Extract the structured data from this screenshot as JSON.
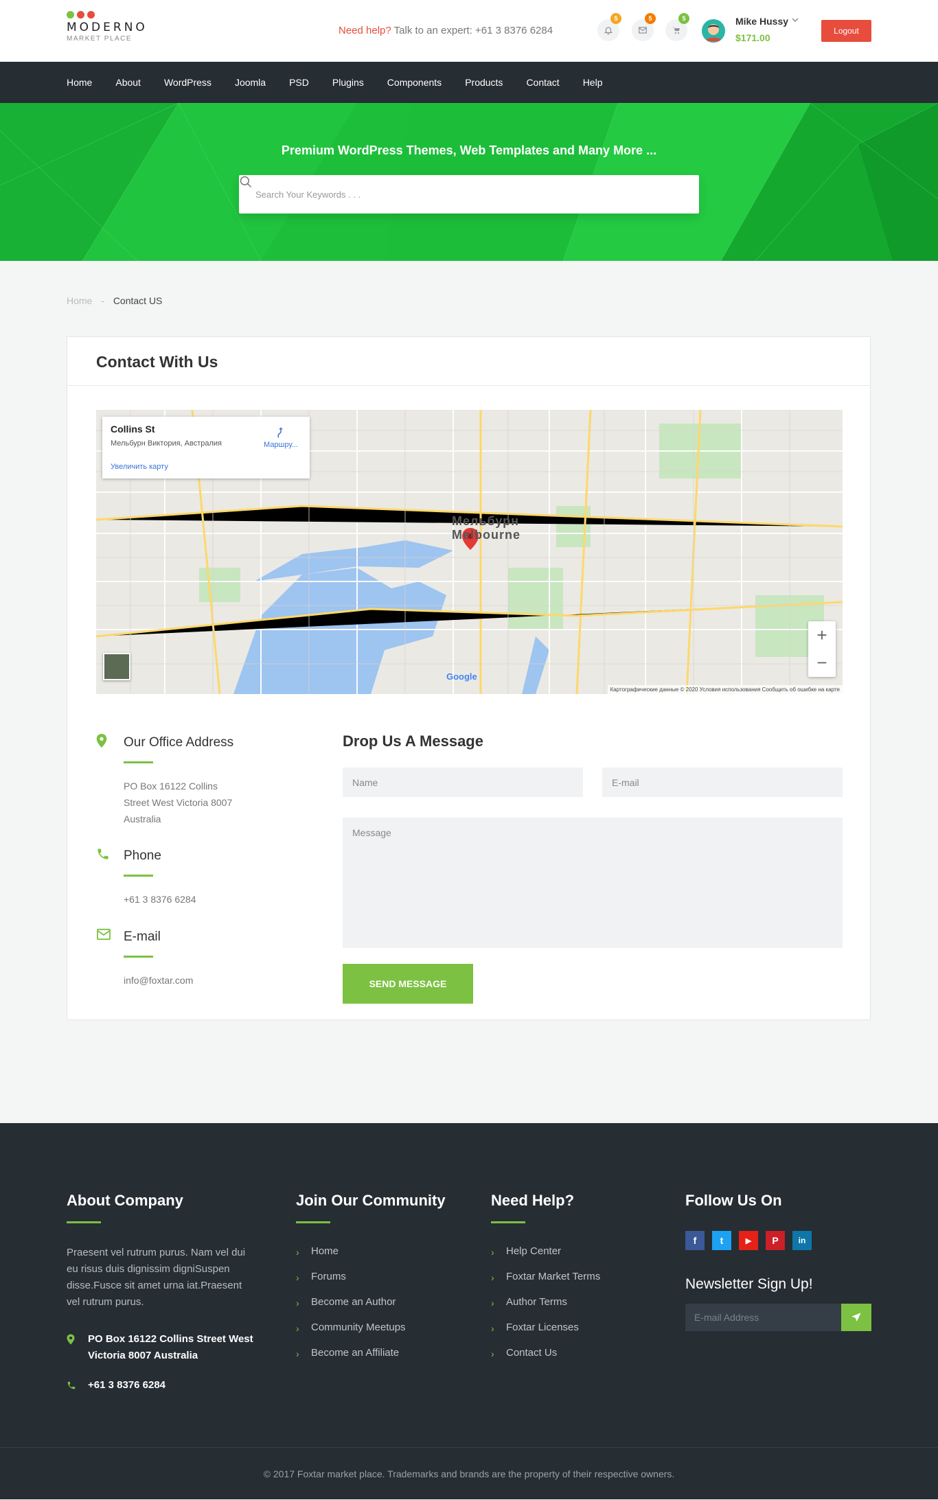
{
  "brand": {
    "name": "MODERNO",
    "sub": "MARKET PLACE",
    "dot_colors": [
      "#7cc142",
      "#e74c3c",
      "#e74c3c"
    ]
  },
  "header": {
    "help_highlight": "Need help?",
    "help_text": "Talk to an expert: +61 3 8376 6284",
    "notifications": {
      "icon": "bell-icon",
      "count": "5"
    },
    "messages": {
      "icon": "envelope-icon",
      "count": "5"
    },
    "cart": {
      "icon": "cart-icon",
      "count": "5"
    },
    "user_name": "Mike Hussy",
    "user_balance": "$171.00",
    "logout_label": "Logout"
  },
  "nav": [
    "Home",
    "About",
    "WordPress",
    "Joomla",
    "PSD",
    "Plugins",
    "Components",
    "Products",
    "Contact",
    "Help"
  ],
  "hero": {
    "title": "Premium WordPress Themes, Web Templates and Many More ...",
    "search_placeholder": "Search Your Keywords . . ."
  },
  "breadcrumb": {
    "home": "Home",
    "sep": "-",
    "current": "Contact US"
  },
  "contact": {
    "title": "Contact With Us",
    "map": {
      "place": "Collins St",
      "address": "Мельбурн Виктория, Австралия",
      "enlarge": "Увеличить карту",
      "route": "Маршру...",
      "city_ru": "Мельбурн",
      "city_en": "Melbourne",
      "google": "Google",
      "attribution": "Картографические данные © 2020   Условия использования   Сообщить об ошибке на карте",
      "zoom_in": "+",
      "zoom_out": "−"
    },
    "office_title": "Our Office Address",
    "office_lines": [
      "PO Box 16122 Collins",
      "Street West Victoria 8007",
      "Australia"
    ],
    "phone_title": "Phone",
    "phone": "+61 3 8376 6284",
    "email_title": "E-mail",
    "email": "info@foxtar.com",
    "form_title": "Drop Us A Message",
    "name_placeholder": "Name",
    "email_placeholder": "E-mail",
    "message_placeholder": "Message",
    "send_label": "SEND MESSAGE"
  },
  "footer": {
    "about_title": "About Company",
    "about_text": "Praesent vel rutrum purus. Nam vel dui eu risus duis dignissim digniSuspen disse.Fusce sit amet urna iat.Praesent vel rutrum purus.",
    "address": "PO Box 16122 Collins Street West Victoria 8007 Australia",
    "phone": "+61 3 8376 6284",
    "community_title": "Join Our Community",
    "community_links": [
      "Home",
      "Forums",
      "Become an Author",
      "Community Meetups",
      "Become an Affiliate"
    ],
    "help_title": "Need Help?",
    "help_links": [
      "Help Center",
      "Foxtar Market Terms",
      "Author Terms",
      "Foxtar Licenses",
      "Contact Us"
    ],
    "follow_title": "Follow Us On",
    "social": [
      {
        "icon": "facebook-icon",
        "glyph": "f",
        "color": "#3b5998"
      },
      {
        "icon": "twitter-icon",
        "glyph": "t",
        "color": "#1da1f2"
      },
      {
        "icon": "youtube-icon",
        "glyph": "▶",
        "color": "#e62117"
      },
      {
        "icon": "pinterest-icon",
        "glyph": "P",
        "color": "#cb2027"
      },
      {
        "icon": "linkedin-icon",
        "glyph": "in",
        "color": "#0e76a8"
      }
    ],
    "newsletter_title": "Newsletter Sign Up!",
    "newsletter_placeholder": "E-mail Address",
    "copyright": "© 2017 Foxtar market place. Trademarks and brands are the property of their respective owners."
  },
  "colors": {
    "accent": "#7cc142",
    "danger": "#e74c3c",
    "dark": "#262d33",
    "hero": "#1fc13c"
  }
}
